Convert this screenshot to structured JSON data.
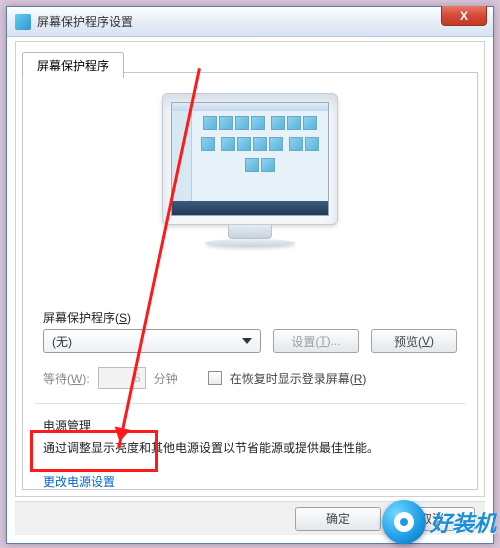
{
  "window": {
    "title": "屏幕保护程序设置",
    "close_label": "X"
  },
  "tab": {
    "label": "屏幕保护程序"
  },
  "screensaver": {
    "section_label_pre": "屏幕保护程序(",
    "section_key": "S",
    "section_label_post": ")",
    "selected": "(无)",
    "settings_btn_pre": "设置(",
    "settings_key": "T",
    "settings_btn_post": ")...",
    "preview_btn_pre": "预览(",
    "preview_key": "V",
    "preview_btn_post": ")",
    "wait_label_pre": "等待(",
    "wait_key": "W",
    "wait_label_post": "):",
    "wait_value": "5",
    "wait_unit": "分钟",
    "resume_label_pre": "在恢复时显示登录屏幕(",
    "resume_key": "R",
    "resume_label_post": ")"
  },
  "power": {
    "section_label": "电源管理",
    "desc": "通过调整显示亮度和其他电源设置以节省能源或提供最佳性能。",
    "link": "更改电源设置"
  },
  "buttons": {
    "ok": "确定",
    "cancel": "取消"
  },
  "watermark": {
    "text": "好装机"
  }
}
